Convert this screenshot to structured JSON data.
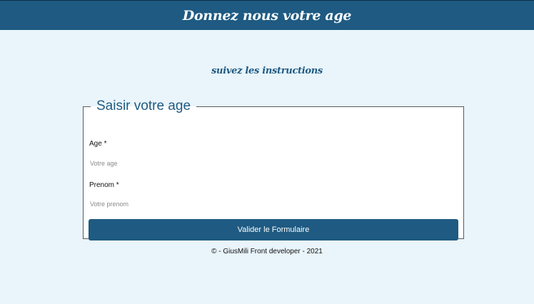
{
  "header": {
    "title": "Donnez nous votre age"
  },
  "subtitle": "suivez les instructions",
  "form": {
    "legend": "Saisir votre age",
    "age_label": "Age *",
    "age_placeholder": "Votre age",
    "age_value": "",
    "prenom_label": "Prenom *",
    "prenom_placeholder": "Votre prenom",
    "prenom_value": "",
    "submit_label": "Valider le Formulaire"
  },
  "footer": {
    "text": "© - GiusMili Front developer - 2021"
  },
  "colors": {
    "brand": "#1e5a82",
    "background": "#e9f4fb",
    "form_background": "#ffffff"
  }
}
